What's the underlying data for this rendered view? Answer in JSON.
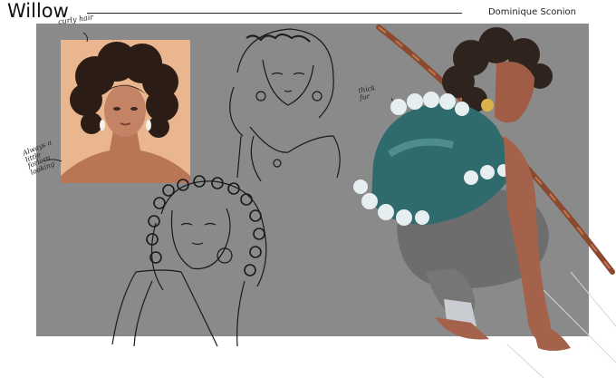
{
  "header": {
    "title": "Willow",
    "artist": "Dominique Sconion"
  },
  "annotations": {
    "curly_hair": "curly hair",
    "always_forlorn": "Always a little forlorn looking",
    "thick_fur": "thick fur"
  },
  "colors": {
    "board": "#8a8a8a",
    "photo_bg": "#e9b690",
    "skin": "#a5624a",
    "cloak": "#2f6a6c",
    "fur": "#e7eef0",
    "pants": "#6d6d6d",
    "staff": "#8b4a2f",
    "hair": "#2e231d"
  }
}
